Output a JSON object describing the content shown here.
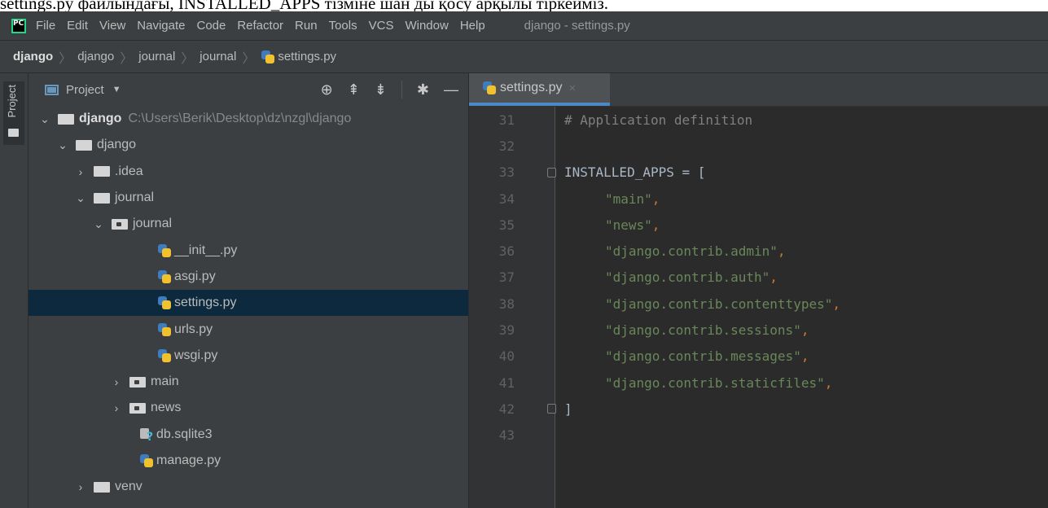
{
  "document": {
    "caption": "settings.py файлындағы, INSTALLED_APPS тізміне шан ды қосу арқылы тіркейміз."
  },
  "menubar": {
    "items": [
      "File",
      "Edit",
      "View",
      "Navigate",
      "Code",
      "Refactor",
      "Run",
      "Tools",
      "VCS",
      "Window",
      "Help"
    ],
    "window_title": "django - settings.py",
    "logo_text": "PC"
  },
  "breadcrumb": [
    "django",
    "django",
    "journal",
    "journal",
    "settings.py"
  ],
  "stripe": {
    "label": "Project"
  },
  "project_panel": {
    "title": "Project",
    "tree": [
      {
        "name": "django",
        "path": "C:\\Users\\Berik\\Desktop\\dz\\nzgl\\django"
      },
      {
        "name": "django"
      },
      {
        "name": ".idea"
      },
      {
        "name": "journal"
      },
      {
        "name": "journal"
      },
      {
        "name": "__init__.py"
      },
      {
        "name": "asgi.py"
      },
      {
        "name": "settings.py"
      },
      {
        "name": "urls.py"
      },
      {
        "name": "wsgi.py"
      },
      {
        "name": "main"
      },
      {
        "name": "news"
      },
      {
        "name": "db.sqlite3"
      },
      {
        "name": "manage.py"
      },
      {
        "name": "venv"
      }
    ]
  },
  "editor": {
    "tab_label": "settings.py",
    "lines": [
      {
        "num": "31",
        "text": "# Application definition"
      },
      {
        "num": "32",
        "text": ""
      },
      {
        "num": "33",
        "text": "INSTALLED_APPS = ["
      },
      {
        "num": "34",
        "text": "\"main\""
      },
      {
        "num": "35",
        "text": "\"news\""
      },
      {
        "num": "36",
        "text": "\"django.contrib.admin\""
      },
      {
        "num": "37",
        "text": "\"django.contrib.auth\""
      },
      {
        "num": "38",
        "text": "\"django.contrib.contenttypes\""
      },
      {
        "num": "39",
        "text": "\"django.contrib.sessions\""
      },
      {
        "num": "40",
        "text": "\"django.contrib.messages\""
      },
      {
        "num": "41",
        "text": "\"django.contrib.staticfiles\""
      },
      {
        "num": "42",
        "text": "]"
      },
      {
        "num": "43",
        "text": ""
      }
    ],
    "comma": ","
  },
  "colors": {
    "comment": "#808080",
    "string": "#6a8759",
    "keyword": "#cc7832",
    "selection": "#0d293e"
  }
}
